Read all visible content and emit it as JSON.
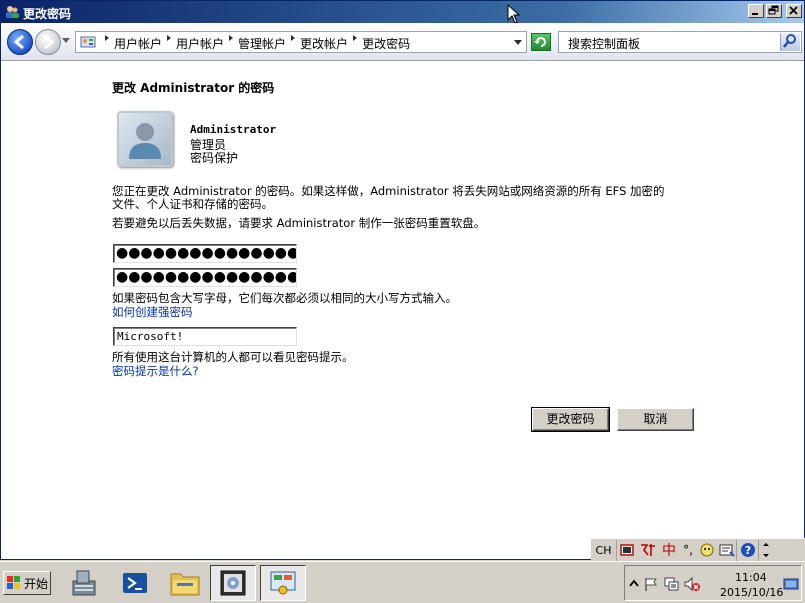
{
  "window": {
    "title": "更改密码"
  },
  "address_bar": {
    "breadcrumbs": [
      "用户帐户",
      "用户帐户",
      "管理帐户",
      "更改帐户",
      "更改密码"
    ],
    "search_placeholder": "搜索控制面板"
  },
  "content": {
    "heading": "更改 Administrator 的密码",
    "account_name": "Administrator",
    "account_type": "管理员",
    "account_protection": "密码保护",
    "warning_line1": "您正在更改 Administrator 的密码。如果这样做，Administrator 将丢失网站或网络资源的所有 EFS 加密的",
    "warning_line2": "文件、个人证书和存储的密码。",
    "reset_disk_note": "若要避免以后丢失数据，请要求 Administrator 制作一张密码重置软盘。",
    "new_password_mask": "●●●●●●●●●●●●●●●",
    "confirm_password_mask": "●●●●●●●●●●●●●●●",
    "case_note": "如果密码包含大写字母，它们每次都必须以相同的大小写方式输入。",
    "strong_password_link": "如何创建强密码",
    "password_hint_value": "Microsoft!",
    "hint_visibility_note": "所有使用这台计算机的人都可以看见密码提示。",
    "hint_what_link": "密码提示是什么?",
    "change_button": "更改密码",
    "cancel_button": "取消"
  },
  "language_bar": {
    "language": "CH",
    "ime_mode": "中",
    "punct": "°,"
  },
  "taskbar": {
    "start_label": "开始",
    "clock_time": "11:04",
    "clock_date": "2015/10/16"
  },
  "colors": {
    "title_gradient_start": "#0a246a",
    "link_blue": "#0033aa",
    "chrome_gray": "#d4d0c8"
  }
}
